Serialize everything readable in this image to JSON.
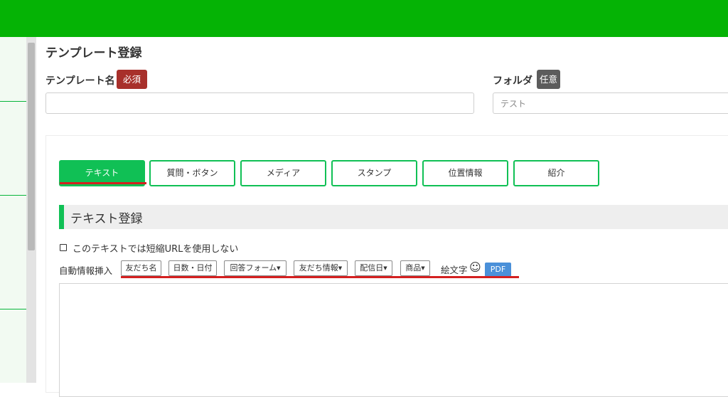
{
  "page": {
    "title": "テンプレート登録"
  },
  "template_name": {
    "label": "テンプレート名",
    "badge": "必須",
    "value": ""
  },
  "folder": {
    "label": "フォルダ",
    "badge": "任意",
    "value": "テスト"
  },
  "tabs": [
    {
      "label": "テキスト",
      "active": true
    },
    {
      "label": "質問・ボタン",
      "active": false
    },
    {
      "label": "メディア",
      "active": false
    },
    {
      "label": "スタンプ",
      "active": false
    },
    {
      "label": "位置情報",
      "active": false
    },
    {
      "label": "紹介",
      "active": false
    }
  ],
  "section": {
    "title": "テキスト登録"
  },
  "short_url": {
    "label": "このテキストでは短縮URLを使用しない",
    "checked": false
  },
  "auto_insert": {
    "label": "自動情報挿入",
    "items": [
      {
        "label": "友だち名",
        "dropdown": false
      },
      {
        "label": "日数・日付",
        "dropdown": false
      },
      {
        "label": "回答フォーム",
        "dropdown": true
      },
      {
        "label": "友だち情報",
        "dropdown": true
      },
      {
        "label": "配信日",
        "dropdown": true
      },
      {
        "label": "商品",
        "dropdown": true
      }
    ],
    "emoji_label": "絵文字",
    "emoji_icon": "☺",
    "pdf_label": "PDF"
  },
  "colors": {
    "header": "#05b305",
    "accent": "#10c055",
    "required": "#a8302b",
    "optional": "#5c5c5c",
    "highlight": "#d42020",
    "pdf": "#4a90d9"
  }
}
